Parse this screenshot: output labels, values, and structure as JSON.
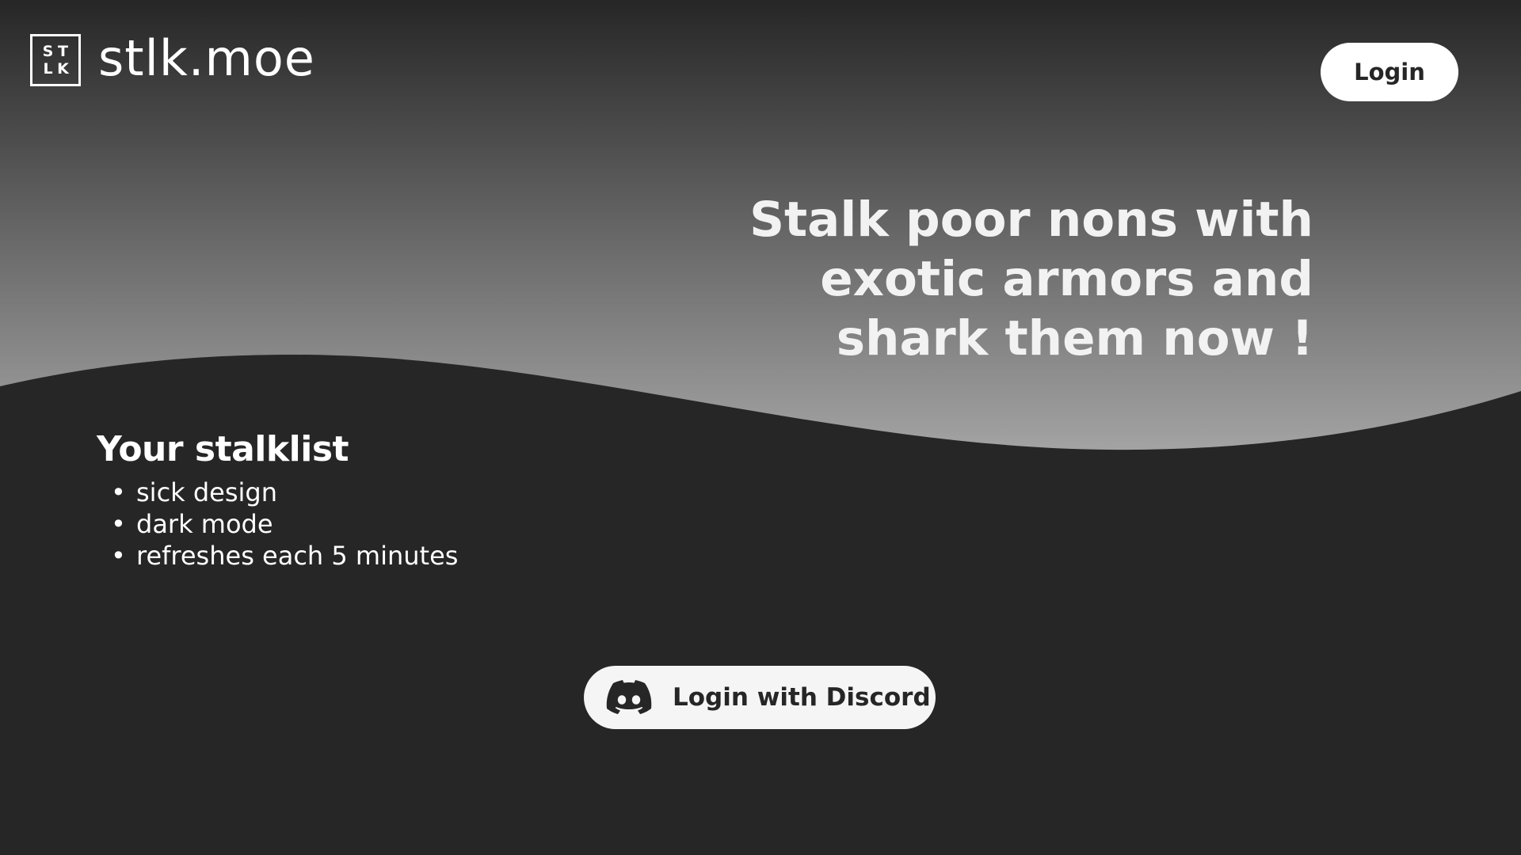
{
  "header": {
    "logo_mark": [
      "S",
      "T",
      "L",
      "K"
    ],
    "site_name": "stlk.moe",
    "login_label": "Login"
  },
  "hero": {
    "tagline_lines": [
      "Stalk poor nons with",
      "exotic armors and",
      "shark them now !"
    ]
  },
  "stalklist": {
    "title": "Your stalklist",
    "items": [
      "sick design",
      "dark mode",
      "refreshes each 5 minutes"
    ]
  },
  "cta": {
    "icon": "discord-icon",
    "label": "Login with Discord"
  },
  "colors": {
    "background": "#262626",
    "gradient_top": "#262626",
    "gradient_bottom": "#a3a3a3",
    "button_bg": "#ffffff",
    "button_text": "#262626"
  }
}
